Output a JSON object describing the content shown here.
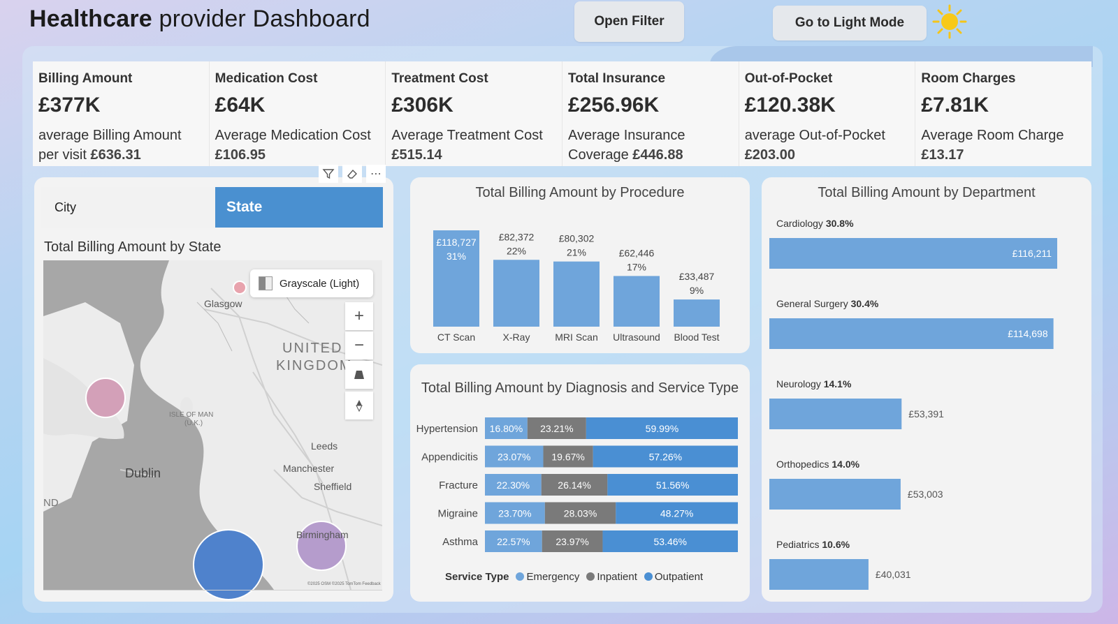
{
  "header": {
    "title_bold": "Healthcare",
    "title_rest": " provider Dashboard",
    "filter_label": "Open Filter",
    "light_mode_label": "Go to Light Mode"
  },
  "kpis": [
    {
      "label": "Billing Amount",
      "value": "£377K",
      "sub_text": "average Billing Amount per visit",
      "sub_value": "£636.31"
    },
    {
      "label": "Medication Cost",
      "value": "£64K",
      "sub_text": "Average Medication Cost",
      "sub_value": "£106.95"
    },
    {
      "label": "Treatment Cost",
      "value": "£306K",
      "sub_text": "Average Treatment Cost",
      "sub_value": "£515.14"
    },
    {
      "label": "Total Insurance",
      "value": "£256.96K",
      "sub_text": "Average Insurance Coverage",
      "sub_value": "£446.88"
    },
    {
      "label": "Out-of-Pocket",
      "value": "£120.38K",
      "sub_text": "average Out-of-Pocket",
      "sub_value": "£203.00"
    },
    {
      "label": "Room Charges",
      "value": "£7.81K",
      "sub_text": "Average Room Charge",
      "sub_value": "£13.17"
    }
  ],
  "slicer": {
    "city": "City",
    "state": "State"
  },
  "map": {
    "title": "Total Billing Amount by State",
    "style": "Grayscale (Light)",
    "labels": {
      "country": "UNITED",
      "country2": "KINGDOM",
      "isle": "ISLE OF MAN",
      "isle2": "(U.K.)",
      "glasgow": "Glasgow",
      "dublin": "Dublin",
      "leeds": "Leeds",
      "manchester": "Manchester",
      "sheffield": "Sheffield",
      "birmingham": "Birmingham",
      "edge": "ND",
      "attrib": "©2025 OSM ©2025 TomTom Feedback"
    }
  },
  "chart_data": [
    {
      "type": "bar",
      "title": "Total Billing Amount by Procedure",
      "categories": [
        "CT Scan",
        "X-Ray",
        "MRI Scan",
        "Ultrasound",
        "Blood Test"
      ],
      "values": [
        118727,
        82372,
        80302,
        62446,
        33487
      ],
      "value_labels": [
        "£118,727",
        "£82,372",
        "£80,302",
        "£62,446",
        "£33,487"
      ],
      "pct_labels": [
        "31%",
        "22%",
        "21%",
        "17%",
        "9%"
      ],
      "color": "#6fa5db"
    },
    {
      "type": "bar",
      "orientation": "horizontal-stacked-100",
      "title": "Total Billing Amount by Diagnosis and Service Type",
      "categories": [
        "Hypertension",
        "Appendicitis",
        "Fracture",
        "Migraine",
        "Asthma"
      ],
      "series": [
        {
          "name": "Emergency",
          "values": [
            16.8,
            23.07,
            22.3,
            23.7,
            22.57
          ],
          "labels": [
            "16.80%",
            "23.07%",
            "22.30%",
            "23.70%",
            "22.57%"
          ],
          "color": "#6fa5db"
        },
        {
          "name": "Inpatient",
          "values": [
            23.21,
            19.67,
            26.14,
            28.03,
            23.97
          ],
          "labels": [
            "23.21%",
            "19.67%",
            "26.14%",
            "28.03%",
            "23.97%"
          ],
          "color": "#7a7a7a"
        },
        {
          "name": "Outpatient",
          "values": [
            59.99,
            57.26,
            51.56,
            48.27,
            53.46
          ],
          "labels": [
            "59.99%",
            "57.26%",
            "51.56%",
            "48.27%",
            "53.46%"
          ],
          "color": "#4a8fd3"
        }
      ],
      "legend_title": "Service Type"
    },
    {
      "type": "bar",
      "orientation": "horizontal",
      "title": "Total Billing Amount by Department",
      "categories": [
        "Cardiology",
        "General Surgery",
        "Neurology",
        "Orthopedics",
        "Pediatrics"
      ],
      "pcts": [
        "30.8%",
        "30.4%",
        "14.1%",
        "14.0%",
        "10.6%"
      ],
      "values": [
        116211,
        114698,
        53391,
        53003,
        40031
      ],
      "value_labels": [
        "£116,211",
        "£114,698",
        "£53,391",
        "£53,003",
        "£40,031"
      ],
      "color": "#6fa5db"
    }
  ]
}
